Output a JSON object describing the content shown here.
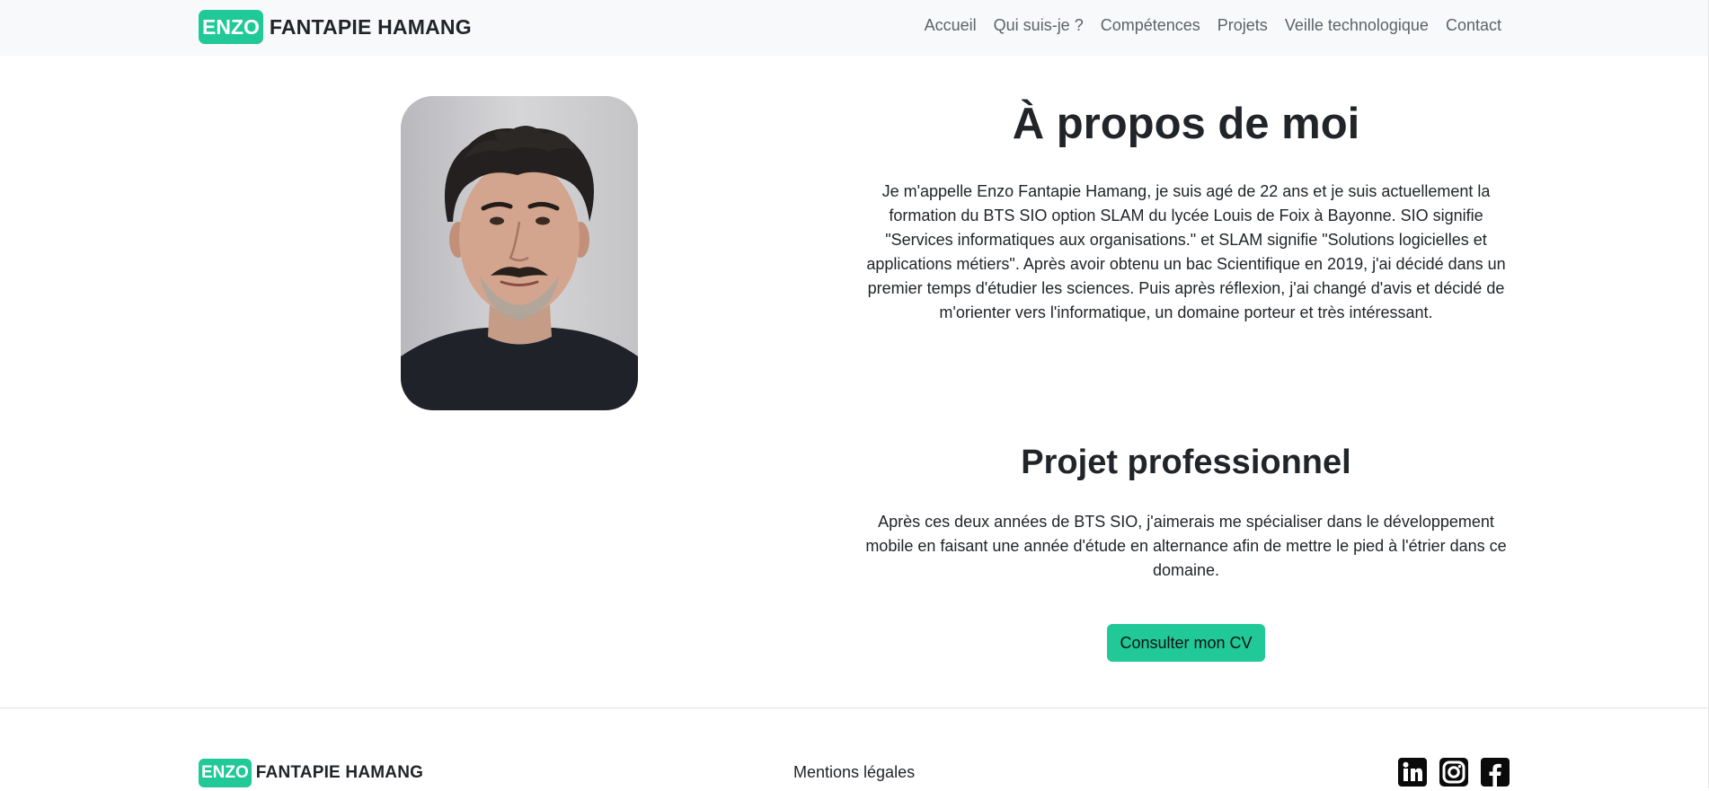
{
  "brand": {
    "badge": "ENZO",
    "name": "FANTAPIE HAMANG"
  },
  "nav": {
    "items": [
      "Accueil",
      "Qui suis-je ?",
      "Compétences",
      "Projets",
      "Veille technologique",
      "Contact"
    ]
  },
  "about": {
    "title": "À propos de moi",
    "text": "Je m'appelle Enzo Fantapie Hamang, je suis agé de 22 ans et je suis actuellement la formation du BTS SIO option SLAM du lycée Louis de Foix à Bayonne. SIO signifie \"Services informatiques aux organisations.\" et SLAM signifie \"Solutions logicielles et applications métiers\". Après avoir obtenu un bac Scientifique en 2019, j'ai décidé dans un premier temps d'étudier les sciences. Puis après réflexion, j'ai changé d'avis et décidé de m'orienter vers l'informatique, un domaine porteur et très intéressant."
  },
  "project": {
    "title": "Projet professionnel",
    "text": "Après ces deux années de BTS SIO, j'aimerais me spécialiser dans le développement mobile en faisant une année d'étude en alternance afin de mettre le pied à l'étrier dans ce domaine.",
    "cv_button": "Consulter mon CV"
  },
  "footer": {
    "brand_badge": "ENZO",
    "brand_name": "FANTAPIE HAMANG",
    "legal": "Mentions légales",
    "socials": [
      "linkedin-icon",
      "instagram-icon",
      "facebook-icon"
    ]
  },
  "colors": {
    "accent": "#20c997",
    "navbar_bg": "#f8f9fa",
    "text": "#212529",
    "nav_link": "#5c636a"
  }
}
